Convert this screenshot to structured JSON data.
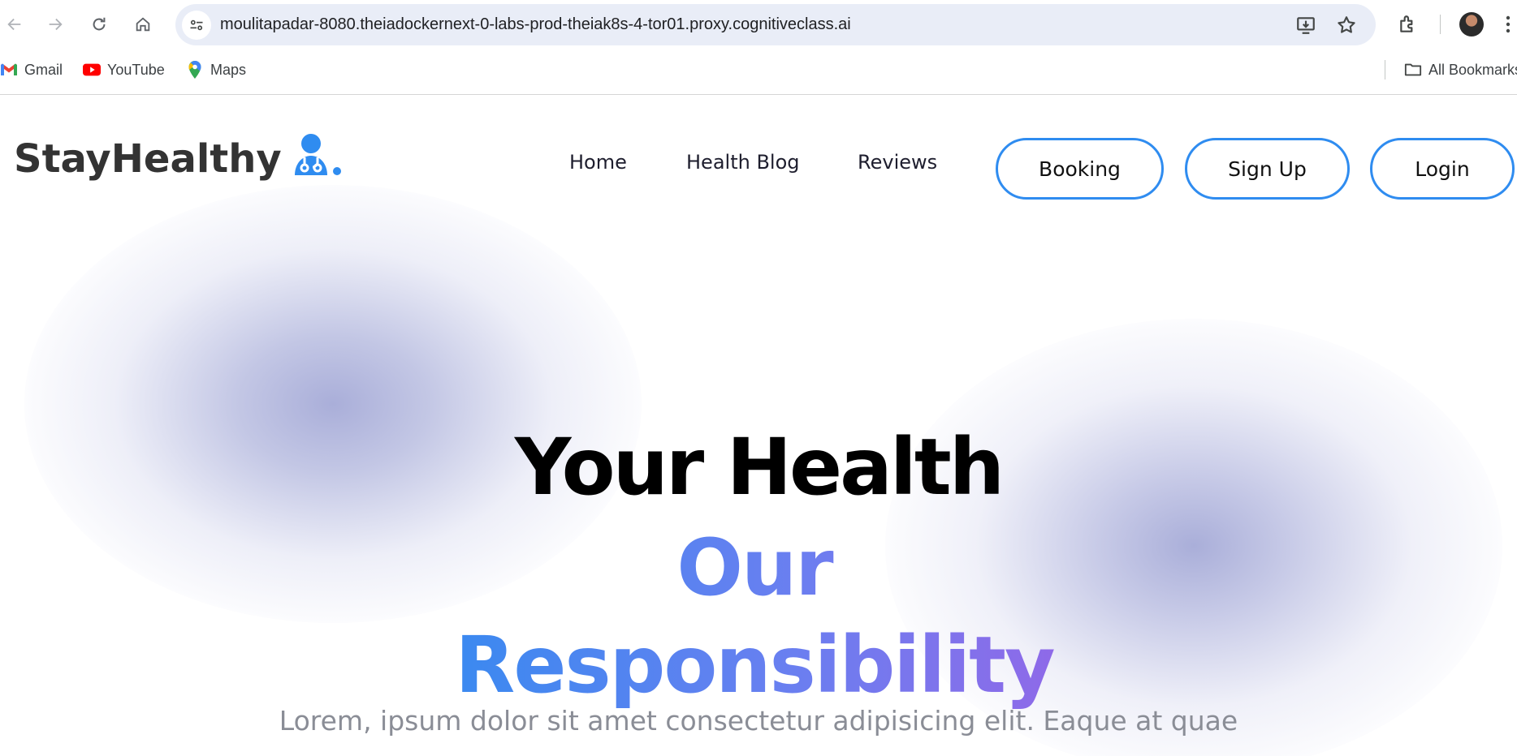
{
  "browser": {
    "url": "moulitapadar-8080.theiadockernext-0-labs-prod-theiak8s-4-tor01.proxy.cognitiveclass.ai",
    "bookmarks": [
      {
        "label": "Gmail",
        "icon": "gmail-icon"
      },
      {
        "label": "YouTube",
        "icon": "youtube-icon"
      },
      {
        "label": "Maps",
        "icon": "maps-icon"
      }
    ],
    "all_bookmarks_label": "All Bookmarks"
  },
  "site": {
    "logo_text": "StayHealthy",
    "logo_icon": "doctor-icon",
    "nav": {
      "home": "Home",
      "blog": "Health Blog",
      "reviews": "Reviews"
    },
    "buttons": {
      "booking": "Booking",
      "signup": "Sign Up",
      "login": "Login"
    },
    "hero": {
      "line1": "Your Health",
      "line2": "Our Responsibility",
      "paragraph": "Lorem, ipsum dolor sit amet consectetur adipisicing elit. Eaque at quae"
    }
  },
  "colors": {
    "accent": "#2f8cf0",
    "gradient_end": "#9a63e6",
    "text_dark": "#333333",
    "muted": "#8a8d96"
  }
}
